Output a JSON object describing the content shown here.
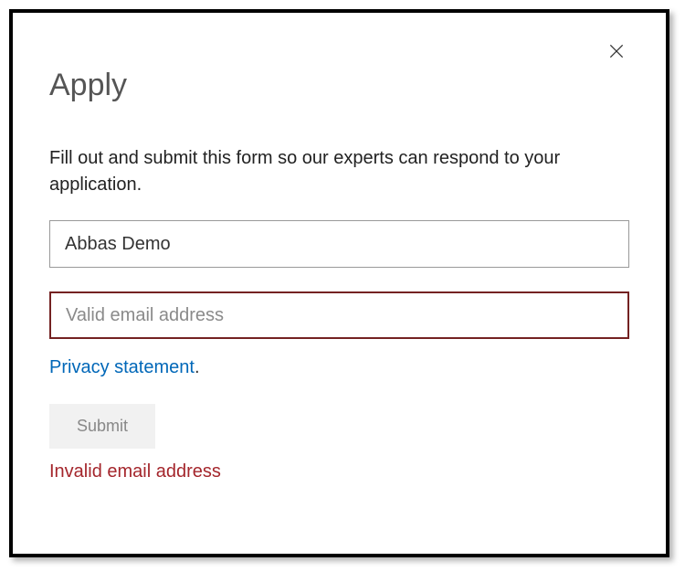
{
  "dialog": {
    "title": "Apply",
    "description": "Fill out and submit this form so our experts can respond to your application.",
    "name_value": "Abbas Demo",
    "email_placeholder": "Valid email address",
    "email_value": "",
    "privacy_link_text": "Privacy statement",
    "privacy_period": ".",
    "submit_label": "Submit",
    "error_message": "Invalid email address"
  }
}
